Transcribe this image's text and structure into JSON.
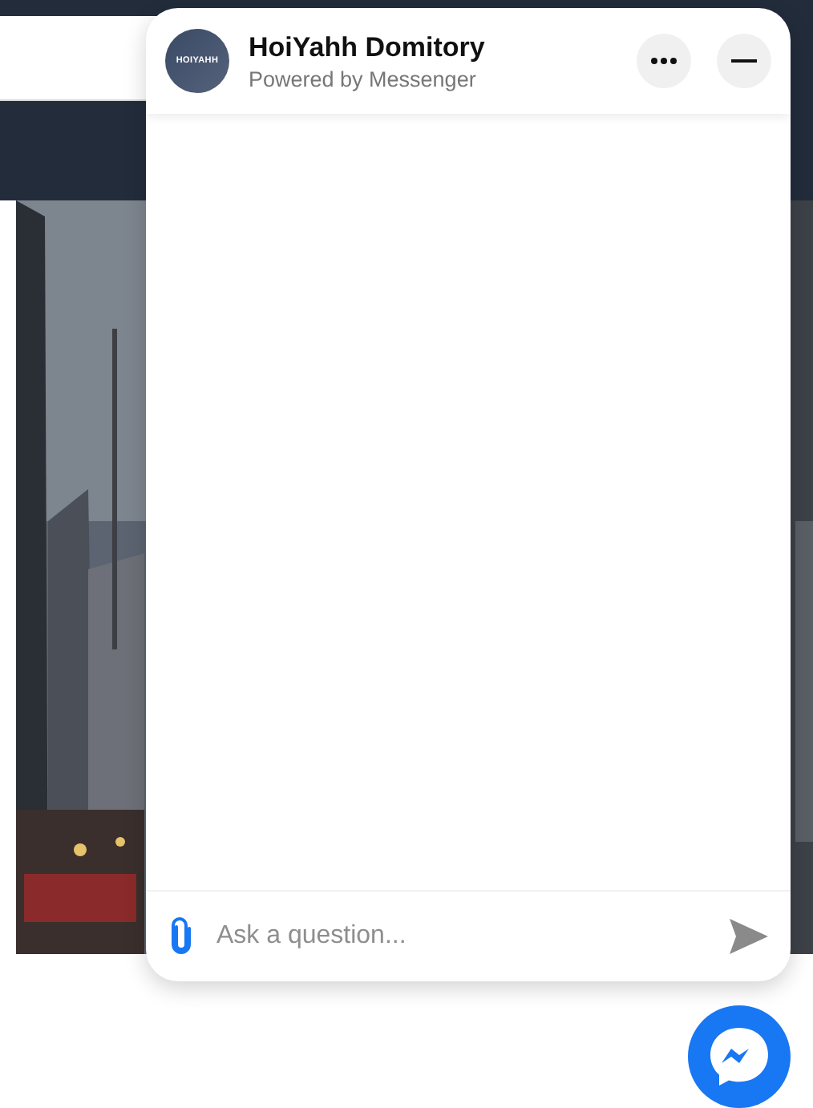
{
  "chat": {
    "avatar_text": "HOIYAHH",
    "title": "HoiYahh Domitory",
    "subtitle": "Powered by Messenger",
    "composer": {
      "placeholder": "Ask a question..."
    }
  }
}
